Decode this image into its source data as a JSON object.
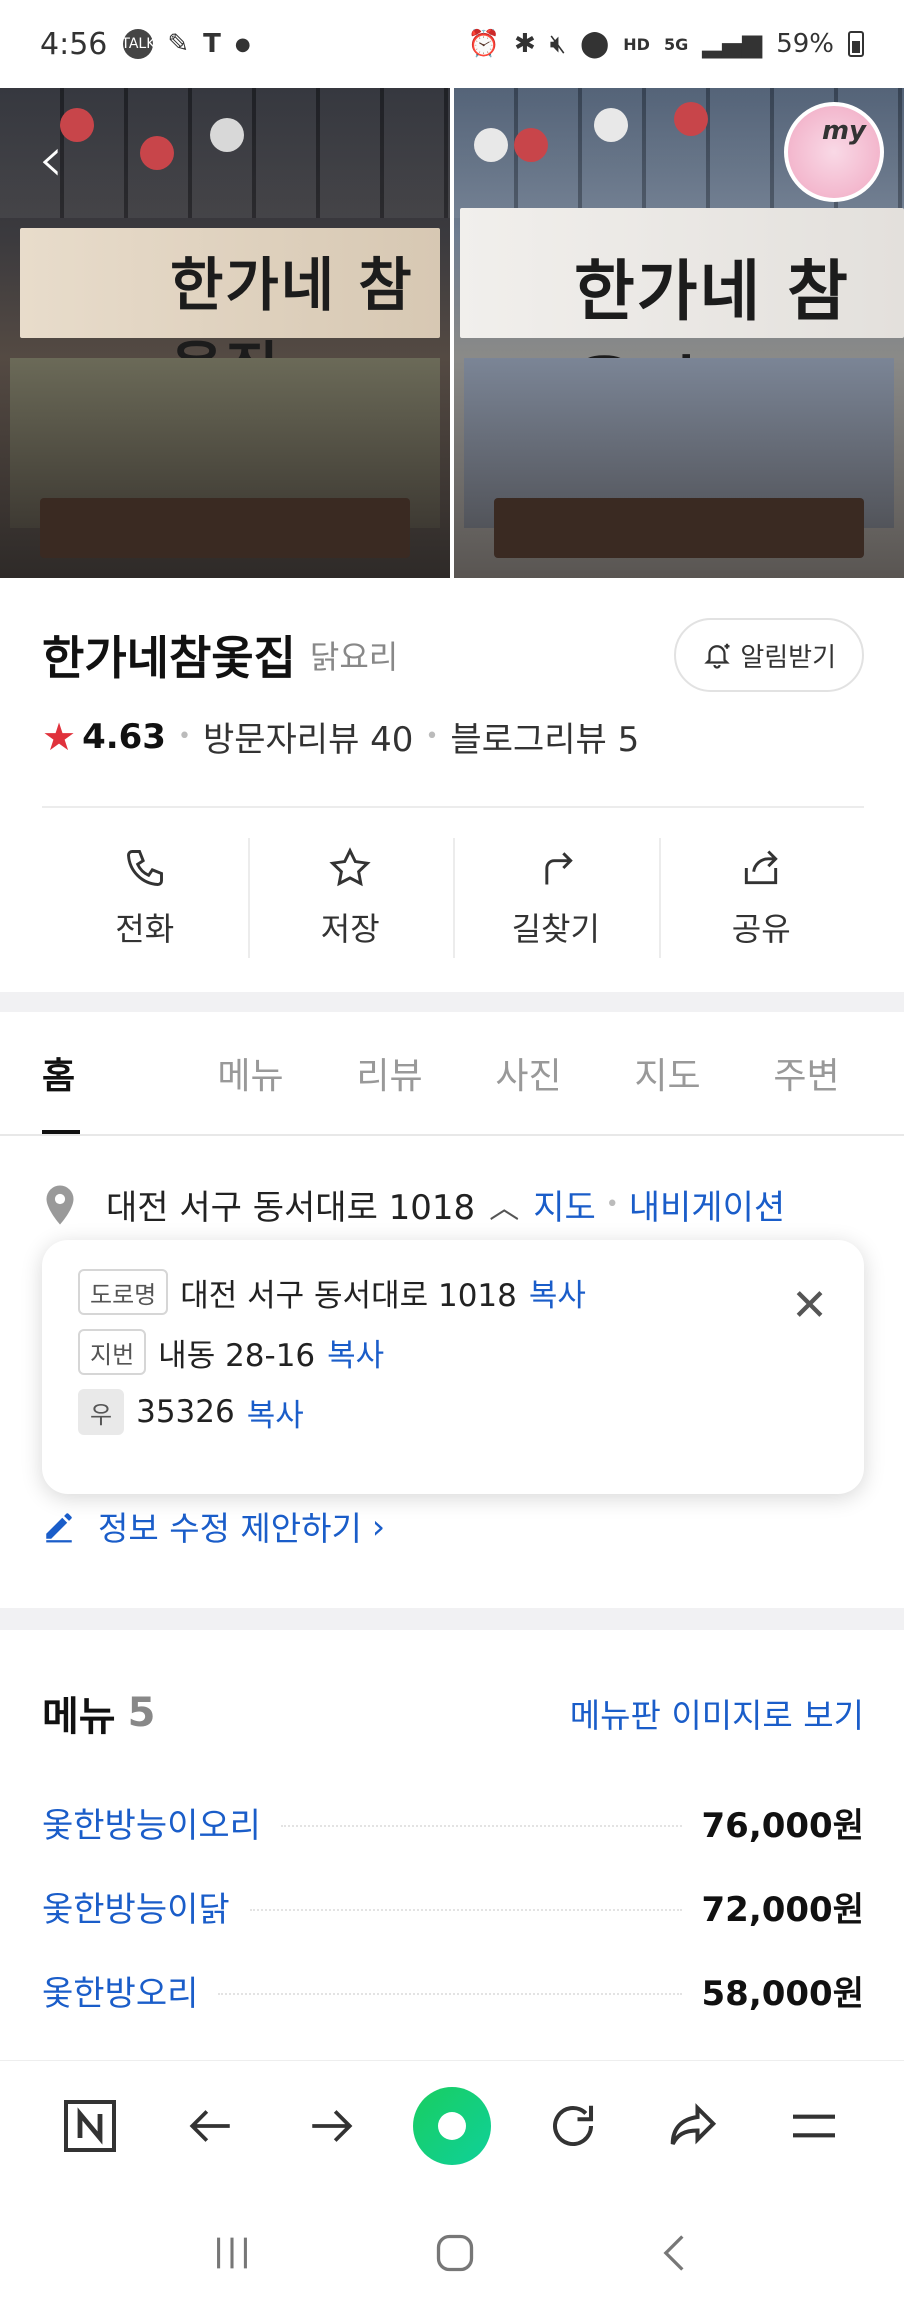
{
  "status_bar": {
    "time": "4:56",
    "left_icons": [
      "talk-icon",
      "edit-icon",
      "t-icon",
      "dot-icon"
    ],
    "talk_label": "TALK",
    "t_label": "T",
    "network": "5G",
    "hd_label": "HD",
    "battery": "59%",
    "right_icons": [
      "alarm-icon",
      "bluetooth-icon",
      "mute-icon",
      "location-icon",
      "hd-voice-icon",
      "5g-icon",
      "signal-icon",
      "battery-icon"
    ]
  },
  "photos": {
    "left_sign": "한가네 참옻집",
    "right_sign": "한가네 참옻집",
    "my_badge": "my"
  },
  "place": {
    "name": "한가네참옻집",
    "category": "닭요리",
    "alarm_label": "알림받기",
    "rating": "4.63",
    "visitor_review": "방문자리뷰 40",
    "blog_review": "블로그리뷰 5"
  },
  "actions": [
    {
      "label": "전화",
      "icon": "phone-icon"
    },
    {
      "label": "저장",
      "icon": "star-icon"
    },
    {
      "label": "길찾기",
      "icon": "directions-icon"
    },
    {
      "label": "공유",
      "icon": "share-icon"
    }
  ],
  "tabs": [
    "홈",
    "메뉴",
    "리뷰",
    "사진",
    "지도",
    "주변"
  ],
  "address": {
    "main": "대전 서구 동서대로 1018",
    "map_link": "지도",
    "navi_link": "내비게이션",
    "road_tag": "도로명",
    "road": "대전 서구 동서대로 1018",
    "lot_tag": "지번",
    "lot": "내동 28-16",
    "zip_tag": "우",
    "zip": "35326",
    "copy_label": "복사"
  },
  "edit_suggestion": "정보 수정 제안하기",
  "menu": {
    "title": "메뉴",
    "count": "5",
    "view_image_link": "메뉴판 이미지로 보기",
    "items": [
      {
        "name": "옻한방능이오리",
        "price": "76,000원"
      },
      {
        "name": "옻한방능이닭",
        "price": "72,000원"
      },
      {
        "name": "옻한방오리",
        "price": "58,000원"
      }
    ]
  },
  "toolbar": [
    "naver-icon",
    "back-arrow-icon",
    "forward-arrow-icon",
    "home-icon",
    "refresh-icon",
    "share-arrow-icon",
    "menu-icon"
  ],
  "sysnav": [
    "recent-apps-icon",
    "home-button-icon",
    "back-button-icon"
  ]
}
